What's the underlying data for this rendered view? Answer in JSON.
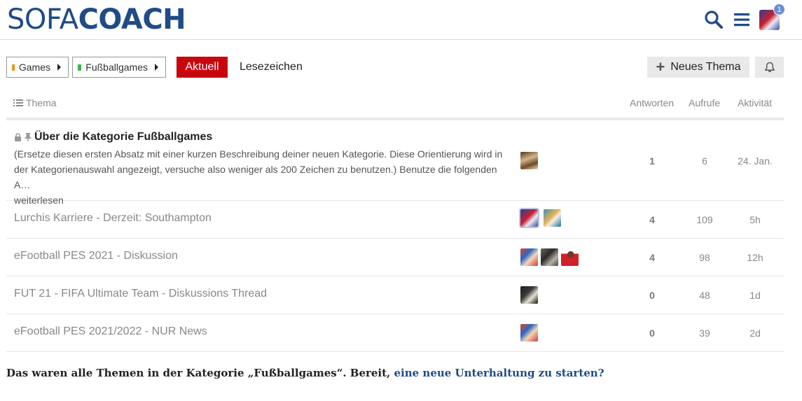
{
  "header": {
    "logo_part1": "SOFA",
    "logo_part2": "COACH",
    "notification_count": "1",
    "icons": [
      "search-icon",
      "hamburger-menu-icon"
    ]
  },
  "nav": {
    "breadcrumbs": [
      {
        "label": "Games",
        "color": "#f0931e"
      },
      {
        "label": "Fußballgames",
        "color": "#3ab54a"
      }
    ],
    "tabs": [
      {
        "label": "Aktuell",
        "active": true
      },
      {
        "label": "Lesezeichen",
        "active": false
      }
    ],
    "new_topic_label": "Neues Thema"
  },
  "table": {
    "headers": {
      "topic": "Thema",
      "replies": "Antworten",
      "views": "Aufrufe",
      "activity": "Aktivität"
    },
    "pinned": {
      "title": "Über die Kategorie Fußballgames",
      "excerpt": "(Ersetze diesen ersten Absatz mit einer kurzen Beschreibung deiner neuen Kategorie. Diese Orientierung wird in der Kategorienauswahl angezeigt, versuche also weniger als 200 Zeichen zu benutzen.) Benutze die folgenden A…",
      "read_more": "weiterlesen",
      "replies": "1",
      "views": "6",
      "activity": "24. Jan."
    },
    "rows": [
      {
        "title": "Lurchis Karriere - Derzeit: Southampton",
        "replies": "4",
        "views": "109",
        "activity": "5h"
      },
      {
        "title": "eFootball PES 2021 - Diskussion",
        "replies": "4",
        "views": "98",
        "activity": "12h"
      },
      {
        "title": "FUT 21 - FIFA Ultimate Team - Diskussions Thread",
        "replies": "0",
        "views": "48",
        "activity": "1d"
      },
      {
        "title": "eFootball PES 2021/2022 - NUR News",
        "replies": "0",
        "views": "39",
        "activity": "2d"
      }
    ]
  },
  "footer": {
    "text": "Das waren alle Themen in der Kategorie „Fußballgames“. Bereit, ",
    "link": "eine neue Unterhaltung zu starten?"
  },
  "colors": {
    "brand": "#1f4b86",
    "accent_active_tab": "#c8060e"
  }
}
